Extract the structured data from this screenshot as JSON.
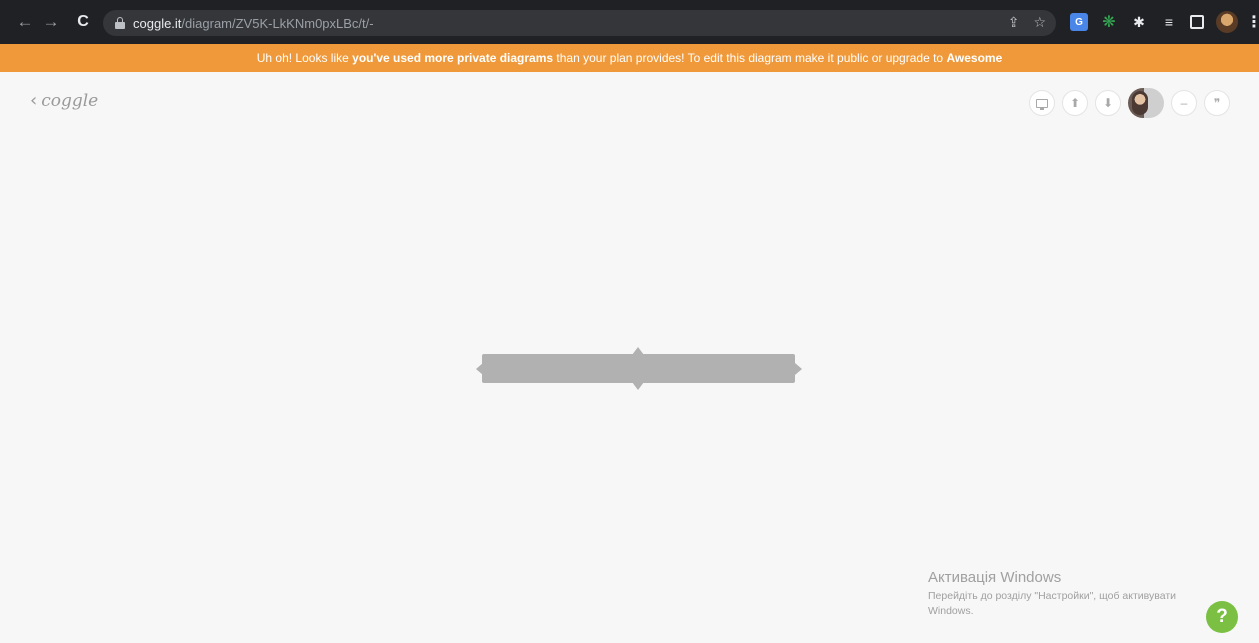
{
  "browser": {
    "url_host": "coggle.it",
    "url_path": "/diagram/ZV5K-LkKNm0pxLBc/t/-",
    "back_icon": "arrow-left",
    "forward_icon": "arrow-right",
    "reload_icon": "reload",
    "share_icon": "share",
    "star_icon": "star",
    "extensions": [
      "google-translate-icon",
      "chatgpt-icon",
      "puzzle-icon",
      "reading-list-icon",
      "side-panel-icon",
      "profile-avatar",
      "kebab-menu-icon"
    ]
  },
  "banner": {
    "prefix": "Uh oh! Looks like ",
    "bold1": "you've used more private diagrams",
    "middle": " than your plan provides! To edit this diagram make it public or upgrade to ",
    "bold2": "Awesome",
    "color": "#f0993a"
  },
  "app": {
    "logo": "coggle",
    "toolbar": [
      "present-icon",
      "upload-icon",
      "download-icon",
      "collaborator-avatar",
      "minus-icon",
      "quote-icon"
    ],
    "node": {
      "text": "",
      "color": "#b1b1b1"
    },
    "help_label": "?",
    "help_color": "#7bc043"
  },
  "watermark": {
    "title": "Активація Windows",
    "subtitle": "Перейдіть до розділу \"Настройки\", щоб активувати Windows."
  }
}
